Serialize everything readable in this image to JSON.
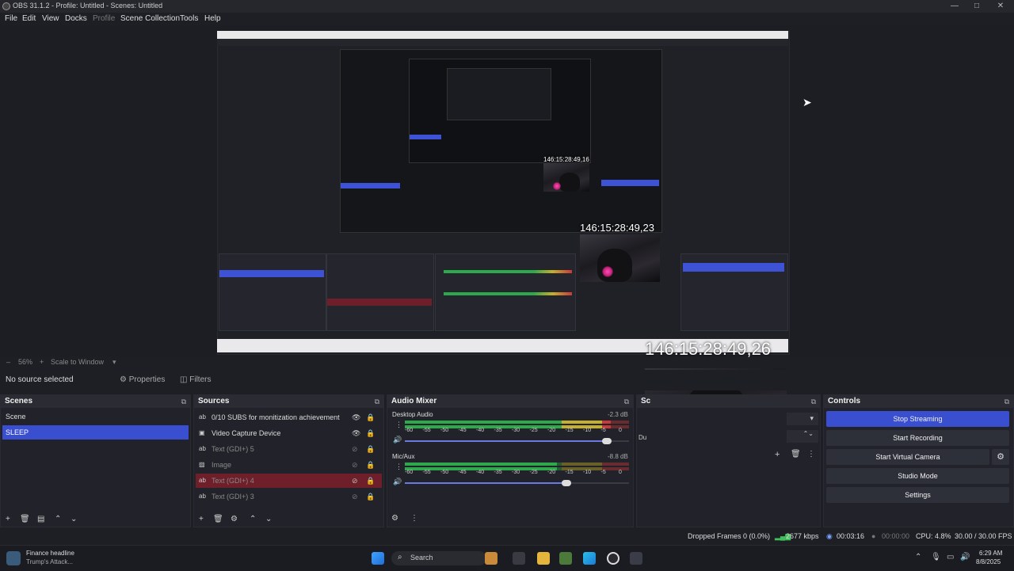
{
  "window": {
    "title": "OBS 31.1.2 - Profile: Untitled - Scenes: Untitled",
    "controls": {
      "minimize": "—",
      "maximize": "□",
      "close": "✕"
    }
  },
  "menu": {
    "items": [
      "File",
      "Edit",
      "View",
      "Docks",
      "Profile",
      "Scene Collection",
      "Tools",
      "Help"
    ]
  },
  "preview": {
    "overlay_text_large": "146:15:28:49,26",
    "overlay_text_medium": "146:15:28:49,23",
    "overlay_text_small": "146:15:28:49,16",
    "zoom": "56%",
    "zoom_mode": "Scale to Window",
    "zoom_minus": "–",
    "zoom_plus": "+",
    "caret": "▾"
  },
  "source_bar": {
    "no_source": "No source selected",
    "properties": "Properties",
    "filters": "Filters"
  },
  "scenes": {
    "title": "Scenes",
    "items": [
      {
        "label": "Scene",
        "selected": false
      },
      {
        "label": "SLEEP",
        "selected": true
      }
    ]
  },
  "sources": {
    "title": "Sources",
    "items": [
      {
        "icon": "ab",
        "label": "0/10 SUBS for monitization achievement",
        "visible": true,
        "state": "normal"
      },
      {
        "icon": "▣",
        "label": "Video Capture Device",
        "visible": true,
        "state": "normal"
      },
      {
        "icon": "ab",
        "label": "Text (GDI+) 5",
        "visible": false,
        "state": "dim"
      },
      {
        "icon": "▨",
        "label": "Image",
        "visible": false,
        "state": "dim"
      },
      {
        "icon": "ab",
        "label": "Text (GDI+) 4",
        "visible": false,
        "state": "red"
      },
      {
        "icon": "ab",
        "label": "Text (GDI+) 3",
        "visible": false,
        "state": "dim"
      }
    ]
  },
  "audio_mixer": {
    "title": "Audio Mixer",
    "channels": [
      {
        "name": "Desktop Audio",
        "db": "-2.3 dB",
        "level": 0.92,
        "fader": 0.9
      },
      {
        "name": "Mic/Aux",
        "db": "-8.8 dB",
        "level": 0.68,
        "fader": 0.72
      }
    ],
    "ticks": [
      "-60",
      "-55",
      "-50",
      "-45",
      "-40",
      "-35",
      "-30",
      "-25",
      "-20",
      "-15",
      "-10",
      "-5",
      "0"
    ]
  },
  "scene_transitions": {
    "title_partial": "Sc",
    "duration_partial": "Du"
  },
  "controls": {
    "title": "Controls",
    "buttons": {
      "stop_streaming": "Stop Streaming",
      "start_recording": "Start Recording",
      "start_virtual_camera": "Start Virtual Camera",
      "studio_mode": "Studio Mode",
      "settings": "Settings"
    }
  },
  "status": {
    "dropped_frames": "Dropped Frames 0 (0.0%)",
    "bitrate": "2677 kbps",
    "stream_time": "00:03:16",
    "record_time": "00:00:00",
    "cpu": "CPU: 4.8%",
    "fps": "30.00 / 30.00 FPS"
  },
  "taskbar": {
    "news_title": "Finance headline",
    "news_sub": "Trump's Attack...",
    "search": "Search",
    "time": "6:29 AM",
    "date": "8/8/2025"
  },
  "colors": {
    "accent": "#3a4fd0",
    "panel": "#22232a",
    "background": "#1e1f25",
    "meter_green": "#2da84a",
    "meter_yellow": "#c4b02c",
    "meter_red": "#c83a3a",
    "warning_row": "#6f1f2a"
  }
}
